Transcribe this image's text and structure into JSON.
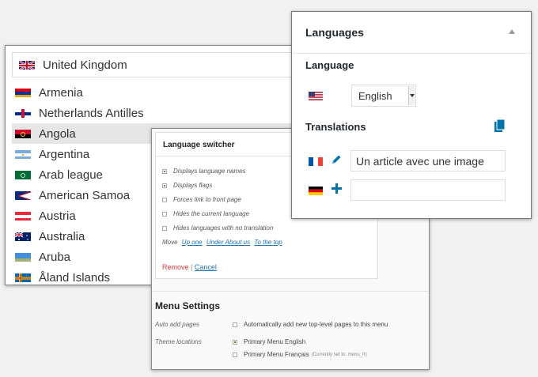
{
  "country_dropdown": {
    "selected": "United Kingdom",
    "items": [
      {
        "label": "Armenia",
        "flag": "armenia-flag-icon"
      },
      {
        "label": "Netherlands Antilles",
        "flag": "netherlands-antilles-flag-icon"
      },
      {
        "label": "Angola",
        "flag": "angola-flag-icon"
      },
      {
        "label": "Argentina",
        "flag": "argentina-flag-icon"
      },
      {
        "label": "Arab league",
        "flag": "arab-league-flag-icon"
      },
      {
        "label": "American Samoa",
        "flag": "american-samoa-flag-icon"
      },
      {
        "label": "Austria",
        "flag": "austria-flag-icon"
      },
      {
        "label": "Australia",
        "flag": "australia-flag-icon"
      },
      {
        "label": "Aruba",
        "flag": "aruba-flag-icon"
      },
      {
        "label": "Åland Islands",
        "flag": "aland-islands-flag-icon"
      }
    ],
    "highlighted_item": "Angola"
  },
  "language_switcher": {
    "title": "Language switcher",
    "options": [
      {
        "label": "Displays language names",
        "checked": true
      },
      {
        "label": "Displays flags",
        "checked": true
      },
      {
        "label": "Forces link to front page",
        "checked": false
      },
      {
        "label": "Hides the current language",
        "checked": false
      },
      {
        "label": "Hides languages with no translation",
        "checked": false
      }
    ],
    "move_label": "Move",
    "move_up": "Up one",
    "move_under": "Under About us",
    "move_top": "To the top",
    "remove_label": "Remove",
    "separator": "|",
    "cancel_label": "Cancel"
  },
  "menu_settings": {
    "title": "Menu Settings",
    "auto_add_label": "Auto add pages",
    "auto_add_option": "Automatically add new top-level pages to this menu",
    "theme_locations_label": "Theme locations",
    "locations": [
      {
        "label": "Primary Menu English",
        "checked": true,
        "note": ""
      },
      {
        "label": "Primary Menu Français",
        "checked": false,
        "note": "(Currently set to: menu_fr)"
      }
    ]
  },
  "languages_box": {
    "title": "Languages",
    "language_heading": "Language",
    "selected_language": "English",
    "translations_heading": "Translations",
    "translations": [
      {
        "flag": "france-flag-icon",
        "action": "pencil-icon",
        "value": "Un article avec une image"
      },
      {
        "flag": "germany-flag-icon",
        "action": "plus-icon",
        "value": ""
      }
    ]
  },
  "colors": {
    "link": "#2271b1",
    "remove": "#d63638",
    "icon_blue": "#0073aa"
  }
}
